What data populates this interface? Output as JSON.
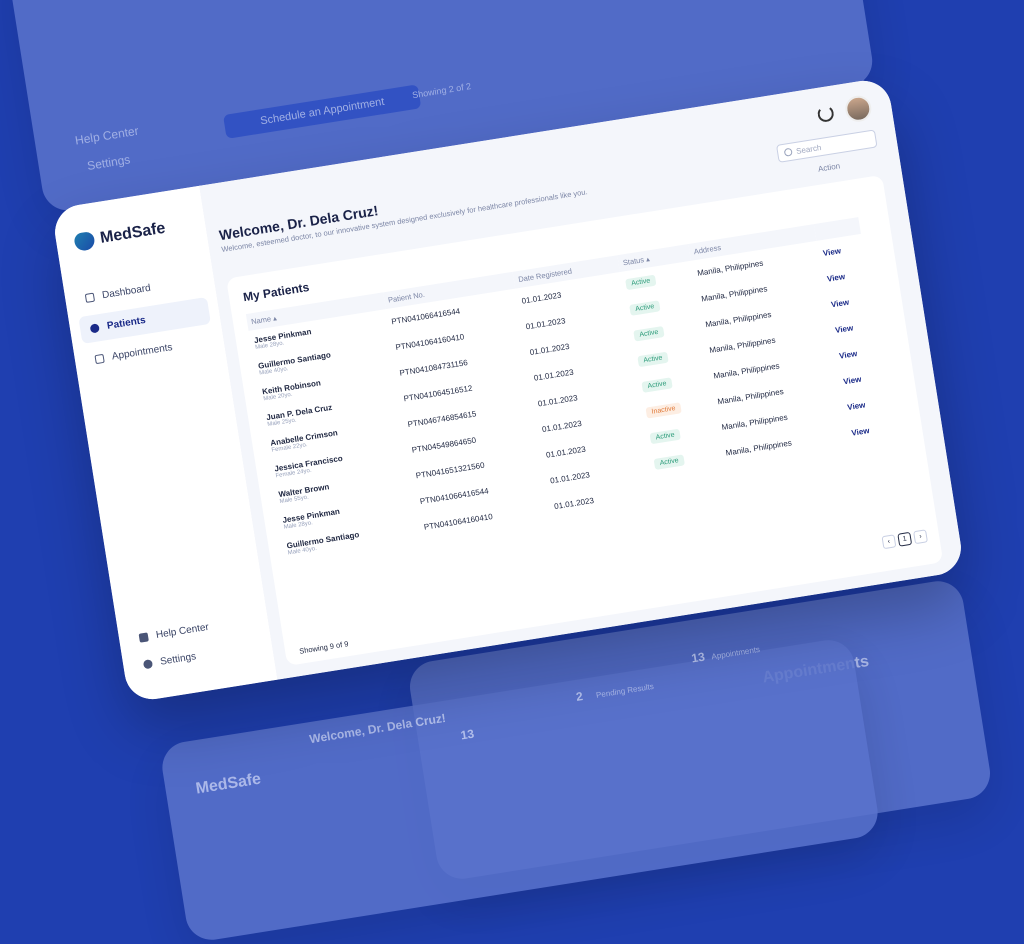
{
  "brand": {
    "name": "MedSafe"
  },
  "sidebar": {
    "items": [
      {
        "label": "Dashboard",
        "icon": "grid-icon",
        "active": false
      },
      {
        "label": "Patients",
        "icon": "user-icon",
        "active": true
      },
      {
        "label": "Appointments",
        "icon": "calendar-icon",
        "active": false
      }
    ],
    "footer": [
      {
        "label": "Help Center",
        "icon": "help-icon"
      },
      {
        "label": "Settings",
        "icon": "gear-icon"
      }
    ]
  },
  "header": {
    "title": "Welcome, Dr. Dela Cruz!",
    "subtitle": "Welcome, esteemed doctor, to our innovative system designed exclusively for healthcare professionals like you."
  },
  "search": {
    "placeholder": "Search"
  },
  "patients": {
    "title": "My Patients",
    "columns": {
      "name": "Name",
      "patient_no": "Patient No.",
      "date": "Date Registered",
      "status": "Status",
      "address": "Address",
      "action": "Action"
    },
    "rows": [
      {
        "name": "Jesse Pinkman",
        "meta": "Male 28yo.",
        "no": "PTN041066416544",
        "date": "01.01.2023",
        "status": "Active",
        "address": "Manila, Philippines",
        "action": "View"
      },
      {
        "name": "Guillermo Santiago",
        "meta": "Male 40yo.",
        "no": "PTN041064160410",
        "date": "01.01.2023",
        "status": "Active",
        "address": "Manila, Philippines",
        "action": "View"
      },
      {
        "name": "Keith Robinson",
        "meta": "Male 20yo.",
        "no": "PTN041084731156",
        "date": "01.01.2023",
        "status": "Active",
        "address": "Manila, Philippines",
        "action": "View"
      },
      {
        "name": "Juan P. Dela Cruz",
        "meta": "Male 25yo.",
        "no": "PTN041064516512",
        "date": "01.01.2023",
        "status": "Active",
        "address": "Manila, Philippines",
        "action": "View"
      },
      {
        "name": "Anabelle Crimson",
        "meta": "Female 22yo.",
        "no": "PTN046746854615",
        "date": "01.01.2023",
        "status": "Active",
        "address": "Manila, Philippines",
        "action": "View"
      },
      {
        "name": "Jessica Francisco",
        "meta": "Female 24yo.",
        "no": "PTN04549864650",
        "date": "01.01.2023",
        "status": "Inactive",
        "address": "Manila, Philippines",
        "action": "View"
      },
      {
        "name": "Walter Brown",
        "meta": "Male 55yo.",
        "no": "PTN041651321560",
        "date": "01.01.2023",
        "status": "Active",
        "address": "Manila, Philippines",
        "action": "View"
      },
      {
        "name": "Jesse Pinkman",
        "meta": "Male 28yo.",
        "no": "PTN041066416544",
        "date": "01.01.2023",
        "status": "Active",
        "address": "Manila, Philippines",
        "action": "View"
      },
      {
        "name": "Guillermo Santiago",
        "meta": "Male 40yo.",
        "no": "PTN041064160410",
        "date": "01.01.2023",
        "status": "",
        "address": "",
        "action": ""
      }
    ],
    "showing": "Showing 9 of 9",
    "pagination": {
      "prev": "‹",
      "current": "1",
      "next": "›"
    }
  },
  "background": {
    "top_help": "Help Center",
    "top_settings_1": "Settings",
    "top_settings_2": "Settings",
    "top_button": "Schedule an Appointment",
    "top_showing": "Showing 2 of 2",
    "bottom_brand": "MedSafe",
    "bottom_welcome": "Welcome, Dr. Dela Cruz!",
    "stat1_value": "13",
    "stat2_value": "2",
    "stat2_label": "Pending Results",
    "stat3_value": "13",
    "stat3_label": "Appointments",
    "appointments_title": "Appointments"
  }
}
